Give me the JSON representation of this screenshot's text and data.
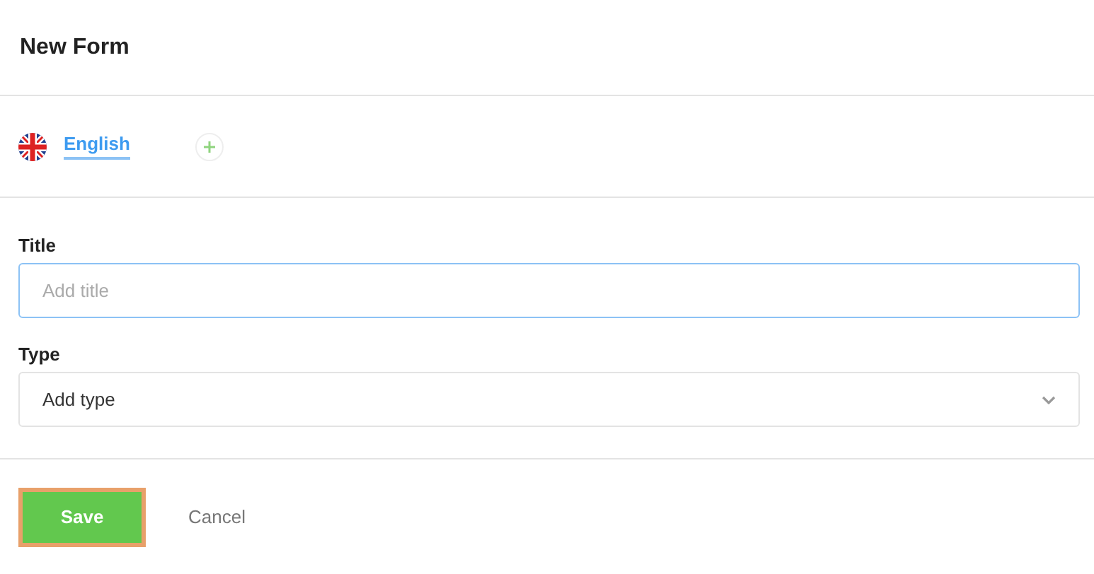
{
  "header": {
    "title": "New Form"
  },
  "languages": [
    {
      "label": "English",
      "selected": true
    }
  ],
  "fields": [
    {
      "kind": "text",
      "label": "Title",
      "placeholder": "Add title",
      "focused": true
    },
    {
      "kind": "select",
      "label": "Type",
      "value": "Add type",
      "focused": false
    }
  ],
  "buttons": [
    {
      "kind": "primary",
      "label": "Save",
      "highlighted": true
    },
    {
      "kind": "link",
      "label": "Cancel",
      "highlighted": false
    }
  ]
}
